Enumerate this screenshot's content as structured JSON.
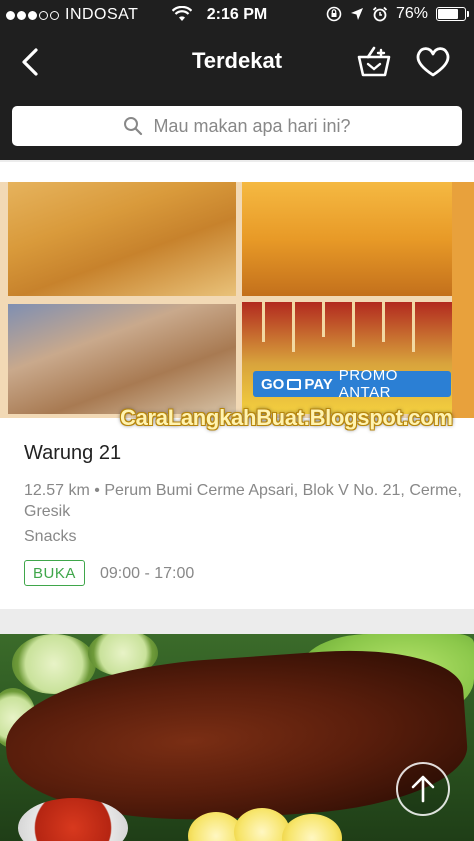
{
  "status_bar": {
    "carrier": "INDOSAT",
    "time": "2:16 PM",
    "battery": "76%",
    "battery_level": 0.76
  },
  "header": {
    "title": "Terdekat",
    "icons": [
      "back-arrow-icon",
      "basket-icon",
      "heart-icon"
    ]
  },
  "search": {
    "placeholder": "Mau makan apa hari ini?"
  },
  "restaurant": {
    "promo_brand": "GO",
    "promo_pay": "PAY",
    "promo_text": "PROMO ANTAR",
    "watermark": "CaraLangkahBuat.Blogspot.com",
    "name": "Warung 21",
    "distance": "12.57 km",
    "address": "Perum Bumi Cerme Apsari, Blok V No. 21, Cerme, Gresik",
    "category": "Snacks",
    "status": "BUKA",
    "hours": "09:00 - 17:00"
  },
  "colors": {
    "header_bg": "#1f1f1f",
    "open_badge": "#3fa64a",
    "promo_bg": "#2b7fd4"
  }
}
